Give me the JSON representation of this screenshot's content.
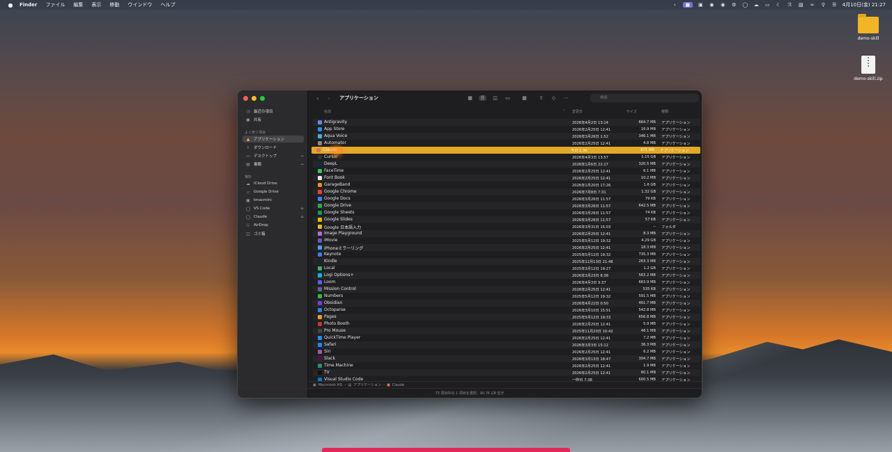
{
  "menubar": {
    "app": "Finder",
    "items": [
      "ファイル",
      "編集",
      "表示",
      "移動",
      "ウインドウ",
      "ヘルプ"
    ],
    "clock": "4月10日(金) 21:27"
  },
  "desktop": {
    "icons": [
      {
        "label": "demo-skill",
        "type": "folder"
      },
      {
        "label": "demo-skill.zip",
        "type": "zip"
      }
    ]
  },
  "finder": {
    "title": "アプリケーション",
    "search_placeholder": "検索",
    "sidebar": {
      "sections": [
        {
          "label": "",
          "items": [
            {
              "label": "最近の項目",
              "icon": "clock-icon"
            },
            {
              "label": "共有",
              "icon": "shared-icon"
            }
          ]
        },
        {
          "label": "よく使う項目",
          "items": [
            {
              "label": "アプリケーション",
              "icon": "apps-icon"
            },
            {
              "label": "ダウンロード",
              "icon": "download-icon"
            },
            {
              "label": "デスクトップ",
              "icon": "desktop-icon"
            },
            {
              "label": "書類",
              "icon": "document-icon"
            }
          ]
        },
        {
          "label": "場所",
          "items": [
            {
              "label": "iCloud Drive",
              "icon": "cloud-icon"
            },
            {
              "label": "Google Drive",
              "icon": "drive-icon"
            },
            {
              "label": "tmacmini",
              "icon": "computer-icon"
            },
            {
              "label": "VS Code",
              "icon": "disk-icon"
            },
            {
              "label": "Claude",
              "icon": "disk-icon"
            },
            {
              "label": "AirDrop",
              "icon": "airdrop-icon"
            },
            {
              "label": "ゴミ箱",
              "icon": "trash-icon"
            }
          ]
        }
      ]
    },
    "columns": {
      "name": "名前",
      "date": "変更日",
      "size": "サイズ",
      "kind": "種類"
    },
    "rows": [
      {
        "name": "Antigravity",
        "date": "2026年4月2日 13:14",
        "size": "664.7 MB",
        "kind": "アプリケーション",
        "color": "#5b8def"
      },
      {
        "name": "App Store",
        "date": "2026年2月25日 12:41",
        "size": "16.9 MB",
        "kind": "アプリケーション",
        "color": "#2d8cf0"
      },
      {
        "name": "Aqua Voice",
        "date": "2026年3月26日 1:52",
        "size": "346.1 MB",
        "kind": "アプリケーション",
        "color": "#3fb6e0"
      },
      {
        "name": "Automator",
        "date": "2026年2月25日 12:41",
        "size": "4.8 MB",
        "kind": "アプリケーション",
        "color": "#8a8a8a"
      },
      {
        "name": "Claude",
        "date": "今日 1:36",
        "size": "671 MB",
        "kind": "アプリケーション",
        "color": "#d9774a",
        "selected": true
      },
      {
        "name": "Cursor",
        "date": "2026年4月3日 13:57",
        "size": "1.15 GB",
        "kind": "アプリケーション",
        "color": "#333333"
      },
      {
        "name": "DeepL",
        "date": "2026年1月6日 22:17",
        "size": "320.5 MB",
        "kind": "アプリケーション",
        "color": "#0f2b46"
      },
      {
        "name": "FaceTime",
        "date": "2026年2月25日 12:41",
        "size": "6.1 MB",
        "kind": "アプリケーション",
        "color": "#34c759"
      },
      {
        "name": "Font Book",
        "date": "2026年2月25日 12:41",
        "size": "10.2 MB",
        "kind": "アプリケーション",
        "color": "#e8e8e8"
      },
      {
        "name": "GarageBand",
        "date": "2026年1月20日 17:26",
        "size": "1.6 GB",
        "kind": "アプリケーション",
        "color": "#f08a24"
      },
      {
        "name": "Google Chrome",
        "date": "2026年7月8日 7:31",
        "size": "1.32 GB",
        "kind": "アプリケーション",
        "color": "#ea4335"
      },
      {
        "name": "Google Docs",
        "date": "2026年3月26日 11:57",
        "size": "79 KB",
        "kind": "アプリケーション",
        "color": "#4285f4"
      },
      {
        "name": "Google Drive",
        "date": "2026年3月26日 11:57",
        "size": "642.5 MB",
        "kind": "アプリケーション",
        "color": "#34a853"
      },
      {
        "name": "Google Sheets",
        "date": "2026年3月26日 11:57",
        "size": "74 KB",
        "kind": "アプリケーション",
        "color": "#0f9d58"
      },
      {
        "name": "Google Slides",
        "date": "2026年3月26日 11:57",
        "size": "57 KB",
        "kind": "アプリケーション",
        "color": "#f4b400"
      },
      {
        "name": "Google 日本語入力",
        "date": "2026年3月31日 15:03",
        "size": "--",
        "kind": "フォルダ",
        "color": "#f2b526"
      },
      {
        "name": "Image Playground",
        "date": "2026年2月25日 12:41",
        "size": "8.3 MB",
        "kind": "アプリケーション",
        "color": "#b86ae0"
      },
      {
        "name": "iMovie",
        "date": "2025年5月12日 19:32",
        "size": "4.29 GB",
        "kind": "アプリケーション",
        "color": "#6a5acd"
      },
      {
        "name": "iPhoneミラーリング",
        "date": "2026年2月25日 12:41",
        "size": "18.3 MB",
        "kind": "アプリケーション",
        "color": "#4a9ef0"
      },
      {
        "name": "Keynote",
        "date": "2025年5月12日 19:32",
        "size": "735.3 MB",
        "kind": "アプリケーション",
        "color": "#3a7de8"
      },
      {
        "name": "Kindle",
        "date": "2025年12月13日 21:48",
        "size": "263.3 MB",
        "kind": "アプリケーション",
        "color": "#222222"
      },
      {
        "name": "Local",
        "date": "2025年3月12日 19:27",
        "size": "1.2 GB",
        "kind": "アプリケーション",
        "color": "#3cb371"
      },
      {
        "name": "Logi Options+",
        "date": "2026年3月23日 8:38",
        "size": "563.2 MB",
        "kind": "アプリケーション",
        "color": "#00b8fc"
      },
      {
        "name": "Loom",
        "date": "2026年4月3日 9:37",
        "size": "663.9 MB",
        "kind": "アプリケーション",
        "color": "#625df5"
      },
      {
        "name": "Mission Control",
        "date": "2026年2月25日 12:41",
        "size": "535 KB",
        "kind": "アプリケーション",
        "color": "#5a6a8a"
      },
      {
        "name": "Numbers",
        "date": "2025年5月12日 19:32",
        "size": "591.5 MB",
        "kind": "アプリケーション",
        "color": "#2fb84a"
      },
      {
        "name": "Obsidian",
        "date": "2026年4月22日 0:50",
        "size": "461.7 MB",
        "kind": "アプリケーション",
        "color": "#7c3aed"
      },
      {
        "name": "Octoparse",
        "date": "2026年3月10日 15:51",
        "size": "542.8 MB",
        "kind": "アプリケーション",
        "color": "#2f80ed"
      },
      {
        "name": "Pages",
        "date": "2025年5月12日 19:33",
        "size": "656.8 MB",
        "kind": "アプリケーション",
        "color": "#f29a2e"
      },
      {
        "name": "Photo Booth",
        "date": "2026年2月25日 12:41",
        "size": "5.9 MB",
        "kind": "アプリケーション",
        "color": "#c0392b"
      },
      {
        "name": "Pro Mouse",
        "date": "2025年11月20日 10:42",
        "size": "46.1 MB",
        "kind": "アプリケーション",
        "color": "#444444"
      },
      {
        "name": "QuickTime Player",
        "date": "2026年2月25日 12:41",
        "size": "7.2 MB",
        "kind": "アプリケーション",
        "color": "#1e90ff"
      },
      {
        "name": "Safari",
        "date": "2026年3月3日 15:12",
        "size": "36.3 MB",
        "kind": "アプリケーション",
        "color": "#1a8cff"
      },
      {
        "name": "Siri",
        "date": "2026年2月25日 12:41",
        "size": "6.2 MB",
        "kind": "アプリケーション",
        "color": "#9b59b6"
      },
      {
        "name": "Slack",
        "date": "2026年3月13日 18:47",
        "size": "304.7 MB",
        "kind": "アプリケーション",
        "color": "#4a154b"
      },
      {
        "name": "Time Machine",
        "date": "2026年2月25日 12:41",
        "size": "1.9 MB",
        "kind": "アプリケーション",
        "color": "#2f8f6f"
      },
      {
        "name": "TV",
        "date": "2026年2月25日 12:41",
        "size": "80.1 MB",
        "kind": "アプリケーション",
        "color": "#111111"
      },
      {
        "name": "Visual Studio Code",
        "date": "一昨日 7:38",
        "size": "600.5 MB",
        "kind": "アプリケーション",
        "color": "#007acc"
      }
    ],
    "pathbar": [
      "Macintosh HD",
      "アプリケーション",
      "Claude"
    ],
    "status": "73 項目中の 1 項目を選択、90.76 GB 空き"
  }
}
